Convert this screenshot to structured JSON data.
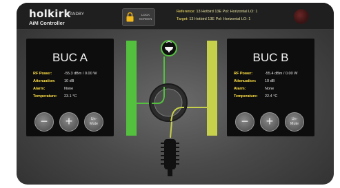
{
  "header": {
    "brand": "holkirk",
    "subtitle": "AiM Controller",
    "status": "STANDBY",
    "lock_button": "LOCK SCREEN",
    "reference_label": "Reference:",
    "reference_value": "13 Hotbird 13E Pol: Horizontal LO: 1",
    "target_label": "Target:",
    "target_value": "13 Hotbird 13E Pol: Horizontal LO: 1"
  },
  "buc_a": {
    "title": "BUC A",
    "rows": [
      {
        "label": "RF Power:",
        "value": "-55.3 dBm / 0.00 W"
      },
      {
        "label": "Attenuation:",
        "value": "10 dB"
      },
      {
        "label": "Alarm:",
        "value": "None"
      },
      {
        "label": "Temperature:",
        "value": "23.1 °C"
      }
    ],
    "minus": "−",
    "plus": "+",
    "mute_line1": "Un-",
    "mute_line2": "Mute"
  },
  "buc_b": {
    "title": "BUC B",
    "rows": [
      {
        "label": "RF Power:",
        "value": "-55.4 dBm / 0.00 W"
      },
      {
        "label": "Attenuation:",
        "value": "10 dB"
      },
      {
        "label": "Alarm:",
        "value": "None"
      },
      {
        "label": "Temperature:",
        "value": "22.4 °C"
      }
    ],
    "minus": "−",
    "plus": "+",
    "mute_line1": "Un-",
    "mute_line2": "Mute"
  },
  "colors": {
    "path_a": "#53c13e",
    "path_b": "#c7d04a",
    "label_yellow": "#ffe045",
    "panel_bg": "#0d0d0d"
  },
  "icons": {
    "antenna": "satellite-dish-icon",
    "load": "dummy-load-icon",
    "switch": "waveguide-switch-icon",
    "lock": "padlock-icon",
    "alarm": "alarm-indicator-icon"
  }
}
